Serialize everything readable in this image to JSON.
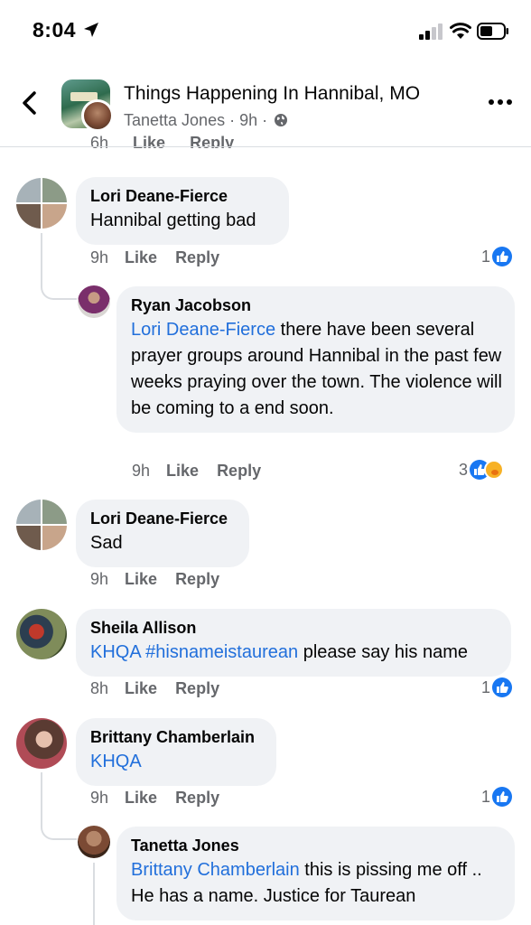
{
  "status_bar": {
    "time": "8:04"
  },
  "header": {
    "group_name": "Things Happening In Hannibal, MO",
    "poster": "Tanetta Jones",
    "sep1": "·",
    "age": "9h",
    "sep2": "·"
  },
  "partial_row": {
    "time": "6h",
    "like": "Like",
    "reply": "Reply"
  },
  "comments": [
    {
      "name": "Lori Deane-Fierce",
      "text": "Hannibal getting bad",
      "time": "9h",
      "like": "Like",
      "reply": "Reply",
      "reactions": "1"
    },
    {
      "name": "Ryan Jacobson",
      "mention": "Lori Deane-Fierce",
      "text": " there have been several prayer groups around Hannibal in the past few weeks praying over the town. The violence will be coming to a end soon.",
      "time": "9h",
      "like": "Like",
      "reply": "Reply",
      "reactions": "3"
    },
    {
      "name": "Lori Deane-Fierce",
      "text": "Sad",
      "time": "9h",
      "like": "Like",
      "reply": "Reply"
    },
    {
      "name": "Sheila Allison",
      "mention": "KHQA #hisnameistaurean",
      "text": " please say his name",
      "time": "8h",
      "like": "Like",
      "reply": "Reply",
      "reactions": "1"
    },
    {
      "name": "Brittany Chamberlain",
      "mention": "KHQA",
      "text": "",
      "time": "9h",
      "like": "Like",
      "reply": "Reply",
      "reactions": "1"
    },
    {
      "name": "Tanetta Jones",
      "mention": "Brittany Chamberlain",
      "text": " this is pissing me off .. He has a name. Justice for Taurean"
    }
  ],
  "icons": {
    "location": "location-arrow-icon",
    "signal": "cellular-signal-icon",
    "wifi": "wifi-icon",
    "battery": "battery-icon",
    "back": "chevron-left-icon",
    "more": "more-dots-icon",
    "globe": "globe-icon",
    "like": "like-reaction-icon",
    "care": "care-reaction-icon"
  },
  "colors": {
    "mention": "#216fdb",
    "like_blue": "#1877f2",
    "bubble": "#f0f2f5",
    "meta": "#65676b"
  }
}
